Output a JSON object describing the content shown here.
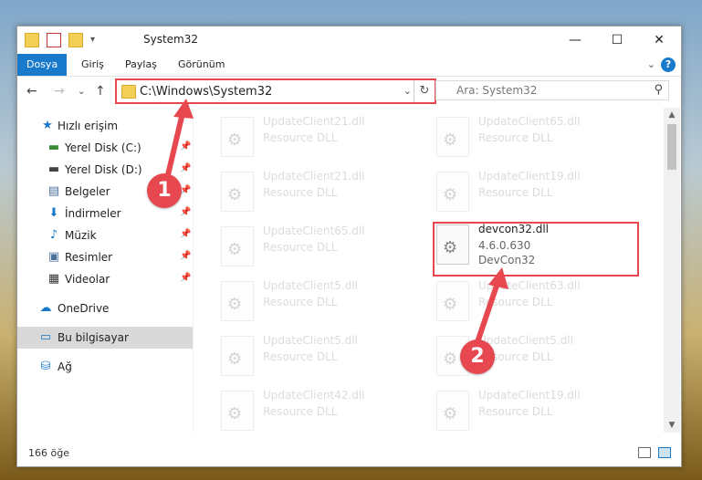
{
  "window": {
    "title": "System32"
  },
  "ribbon": {
    "tabs": [
      "Dosya",
      "Giriş",
      "Paylaş",
      "Görünüm"
    ],
    "help_label": "?"
  },
  "navbar": {
    "address_path": "C:\\Windows\\System32",
    "search_placeholder": "Ara: System32"
  },
  "sidebar": {
    "quick_access": "Hızlı erişim",
    "items": [
      {
        "label": "Yerel Disk (C:)",
        "icon": "drive-icon"
      },
      {
        "label": "Yerel Disk (D:)",
        "icon": "drive-icon"
      },
      {
        "label": "Belgeler",
        "icon": "documents-icon"
      },
      {
        "label": "İndirmeler",
        "icon": "download-icon"
      },
      {
        "label": "Müzik",
        "icon": "music-icon"
      },
      {
        "label": "Resimler",
        "icon": "pictures-icon"
      },
      {
        "label": "Videolar",
        "icon": "videos-icon"
      }
    ],
    "onedrive": "OneDrive",
    "this_pc": "Bu bilgisayar",
    "network": "Ağ"
  },
  "files": [
    {
      "name": "UpdateClient21.dll",
      "sub": "Resource DLL"
    },
    {
      "name": "UpdateClient65.dll",
      "sub": "Resource DLL"
    },
    {
      "name": "UpdateClient21.dll",
      "sub": "Resource DLL"
    },
    {
      "name": "UpdateClient19.dll",
      "sub": "Resource DLL"
    },
    {
      "name": "UpdateClient65.dll",
      "sub": "Resource DLL"
    },
    {
      "name": "devcon32.dll",
      "version": "4.6.0.630",
      "sub": "DevCon32"
    },
    {
      "name": "UpdateClient5.dll",
      "sub": "Resource DLL"
    },
    {
      "name": "UpdateClient63.dll",
      "sub": "Resource DLL"
    },
    {
      "name": "UpdateClient5.dll",
      "sub": "Resource DLL"
    },
    {
      "name": "UpdateClient5.dll",
      "sub": "Resource DLL"
    },
    {
      "name": "UpdateClient42.dll",
      "sub": "Resource DLL"
    },
    {
      "name": "UpdateClient19.dll",
      "sub": "Resource DLL"
    }
  ],
  "status": {
    "item_count": "166 öğe"
  },
  "callouts": [
    "1",
    "2"
  ],
  "colors": {
    "accent": "#1979ca",
    "highlight": "#e74850"
  }
}
